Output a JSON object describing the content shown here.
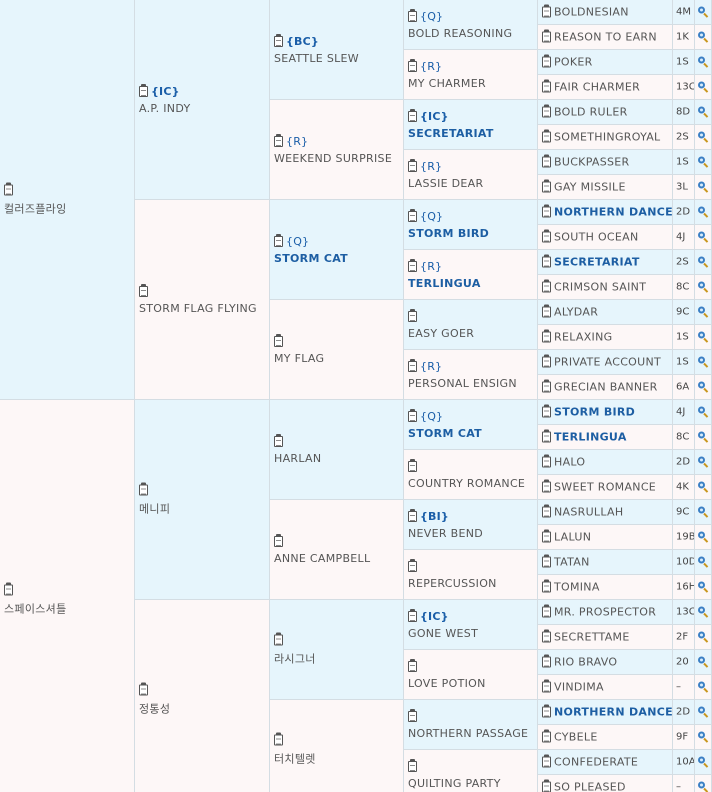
{
  "gen1": [
    {
      "name": "컬러즈플라잉",
      "tag": "",
      "bold": false
    },
    {
      "name": "스페이스셔틀",
      "tag": "",
      "bold": false
    }
  ],
  "gen2": [
    {
      "name": "A.P. INDY",
      "tag": "{IC}",
      "bold": false
    },
    {
      "name": "STORM FLAG FLYING",
      "tag": "",
      "bold": false
    },
    {
      "name": "메니피",
      "tag": "",
      "bold": false
    },
    {
      "name": "정통성",
      "tag": "",
      "bold": false
    }
  ],
  "gen3": [
    {
      "name": "SEATTLE SLEW",
      "tag": "{BC}",
      "bold": false
    },
    {
      "name": "WEEKEND SURPRISE",
      "tag": "{R}",
      "bold": false
    },
    {
      "name": "STORM CAT",
      "tag": "{Q}",
      "bold": true
    },
    {
      "name": "MY FLAG",
      "tag": "",
      "bold": false
    },
    {
      "name": "HARLAN",
      "tag": "",
      "bold": false
    },
    {
      "name": "ANNE CAMPBELL",
      "tag": "",
      "bold": false
    },
    {
      "name": "라시그너",
      "tag": "",
      "bold": false
    },
    {
      "name": "터치텔렛",
      "tag": "",
      "bold": false
    }
  ],
  "gen4": [
    {
      "name": "BOLD REASONING",
      "tag": "{Q}",
      "bold": false
    },
    {
      "name": "MY CHARMER",
      "tag": "{R}",
      "bold": false
    },
    {
      "name": "SECRETARIAT",
      "tag": "{IC}",
      "bold": true
    },
    {
      "name": "LASSIE DEAR",
      "tag": "{R}",
      "bold": false
    },
    {
      "name": "STORM BIRD",
      "tag": "{Q}",
      "bold": true
    },
    {
      "name": "TERLINGUA",
      "tag": "{R}",
      "bold": true
    },
    {
      "name": "EASY GOER",
      "tag": "",
      "bold": false
    },
    {
      "name": "PERSONAL ENSIGN",
      "tag": "{R}",
      "bold": false
    },
    {
      "name": "STORM CAT",
      "tag": "{Q}",
      "bold": true
    },
    {
      "name": "COUNTRY ROMANCE",
      "tag": "",
      "bold": false
    },
    {
      "name": "NEVER BEND",
      "tag": "{BI}",
      "bold": false
    },
    {
      "name": "REPERCUSSION",
      "tag": "",
      "bold": false
    },
    {
      "name": "GONE WEST",
      "tag": "{IC}",
      "bold": false
    },
    {
      "name": "LOVE POTION",
      "tag": "",
      "bold": false
    },
    {
      "name": "NORTHERN PASSAGE",
      "tag": "",
      "bold": false
    },
    {
      "name": "QUILTING PARTY",
      "tag": "",
      "bold": false
    }
  ],
  "gen5": [
    {
      "name": "BOLDNESIAN",
      "code": "4M",
      "bold": false
    },
    {
      "name": "REASON TO EARN",
      "code": "1K",
      "bold": false
    },
    {
      "name": "POKER",
      "code": "1S",
      "bold": false
    },
    {
      "name": "FAIR CHARMER",
      "code": "13C",
      "bold": false
    },
    {
      "name": "BOLD RULER",
      "code": "8D",
      "bold": false
    },
    {
      "name": "SOMETHINGROYAL",
      "code": "2S",
      "bold": false
    },
    {
      "name": "BUCKPASSER",
      "code": "1S",
      "bold": false
    },
    {
      "name": "GAY MISSILE",
      "code": "3L",
      "bold": false
    },
    {
      "name": "NORTHERN DANCER",
      "code": "2D",
      "bold": true
    },
    {
      "name": "SOUTH OCEAN",
      "code": "4J",
      "bold": false
    },
    {
      "name": "SECRETARIAT",
      "code": "2S",
      "bold": true
    },
    {
      "name": "CRIMSON SAINT",
      "code": "8C",
      "bold": false
    },
    {
      "name": "ALYDAR",
      "code": "9C",
      "bold": false
    },
    {
      "name": "RELAXING",
      "code": "1S",
      "bold": false
    },
    {
      "name": "PRIVATE ACCOUNT",
      "code": "1S",
      "bold": false
    },
    {
      "name": "GRECIAN BANNER",
      "code": "6A",
      "bold": false
    },
    {
      "name": "STORM BIRD",
      "code": "4J",
      "bold": true
    },
    {
      "name": "TERLINGUA",
      "code": "8C",
      "bold": true
    },
    {
      "name": "HALO",
      "code": "2D",
      "bold": false
    },
    {
      "name": "SWEET ROMANCE",
      "code": "4K",
      "bold": false
    },
    {
      "name": "NASRULLAH",
      "code": "9C",
      "bold": false
    },
    {
      "name": "LALUN",
      "code": "19B",
      "bold": false
    },
    {
      "name": "TATAN",
      "code": "10D",
      "bold": false
    },
    {
      "name": "TOMINA",
      "code": "16H",
      "bold": false
    },
    {
      "name": "MR. PROSPECTOR",
      "code": "13C",
      "bold": false
    },
    {
      "name": "SECRETTAME",
      "code": "2F",
      "bold": false
    },
    {
      "name": "RIO BRAVO",
      "code": "20",
      "bold": false
    },
    {
      "name": "VINDIMA",
      "code": "–",
      "bold": false
    },
    {
      "name": "NORTHERN DANCER",
      "code": "2D",
      "bold": true
    },
    {
      "name": "CYBELE",
      "code": "9F",
      "bold": false
    },
    {
      "name": "CONFEDERATE",
      "code": "10A",
      "bold": false
    },
    {
      "name": "SO PLEASED",
      "code": "–",
      "bold": false
    }
  ],
  "icons": {
    "clipboard": "clipboard-icon",
    "search": "magnifier-icon"
  },
  "colors": {
    "sire_bg": "#e6f5fc",
    "dam_bg": "#fdf7f7",
    "link": "#1d5ea3"
  }
}
